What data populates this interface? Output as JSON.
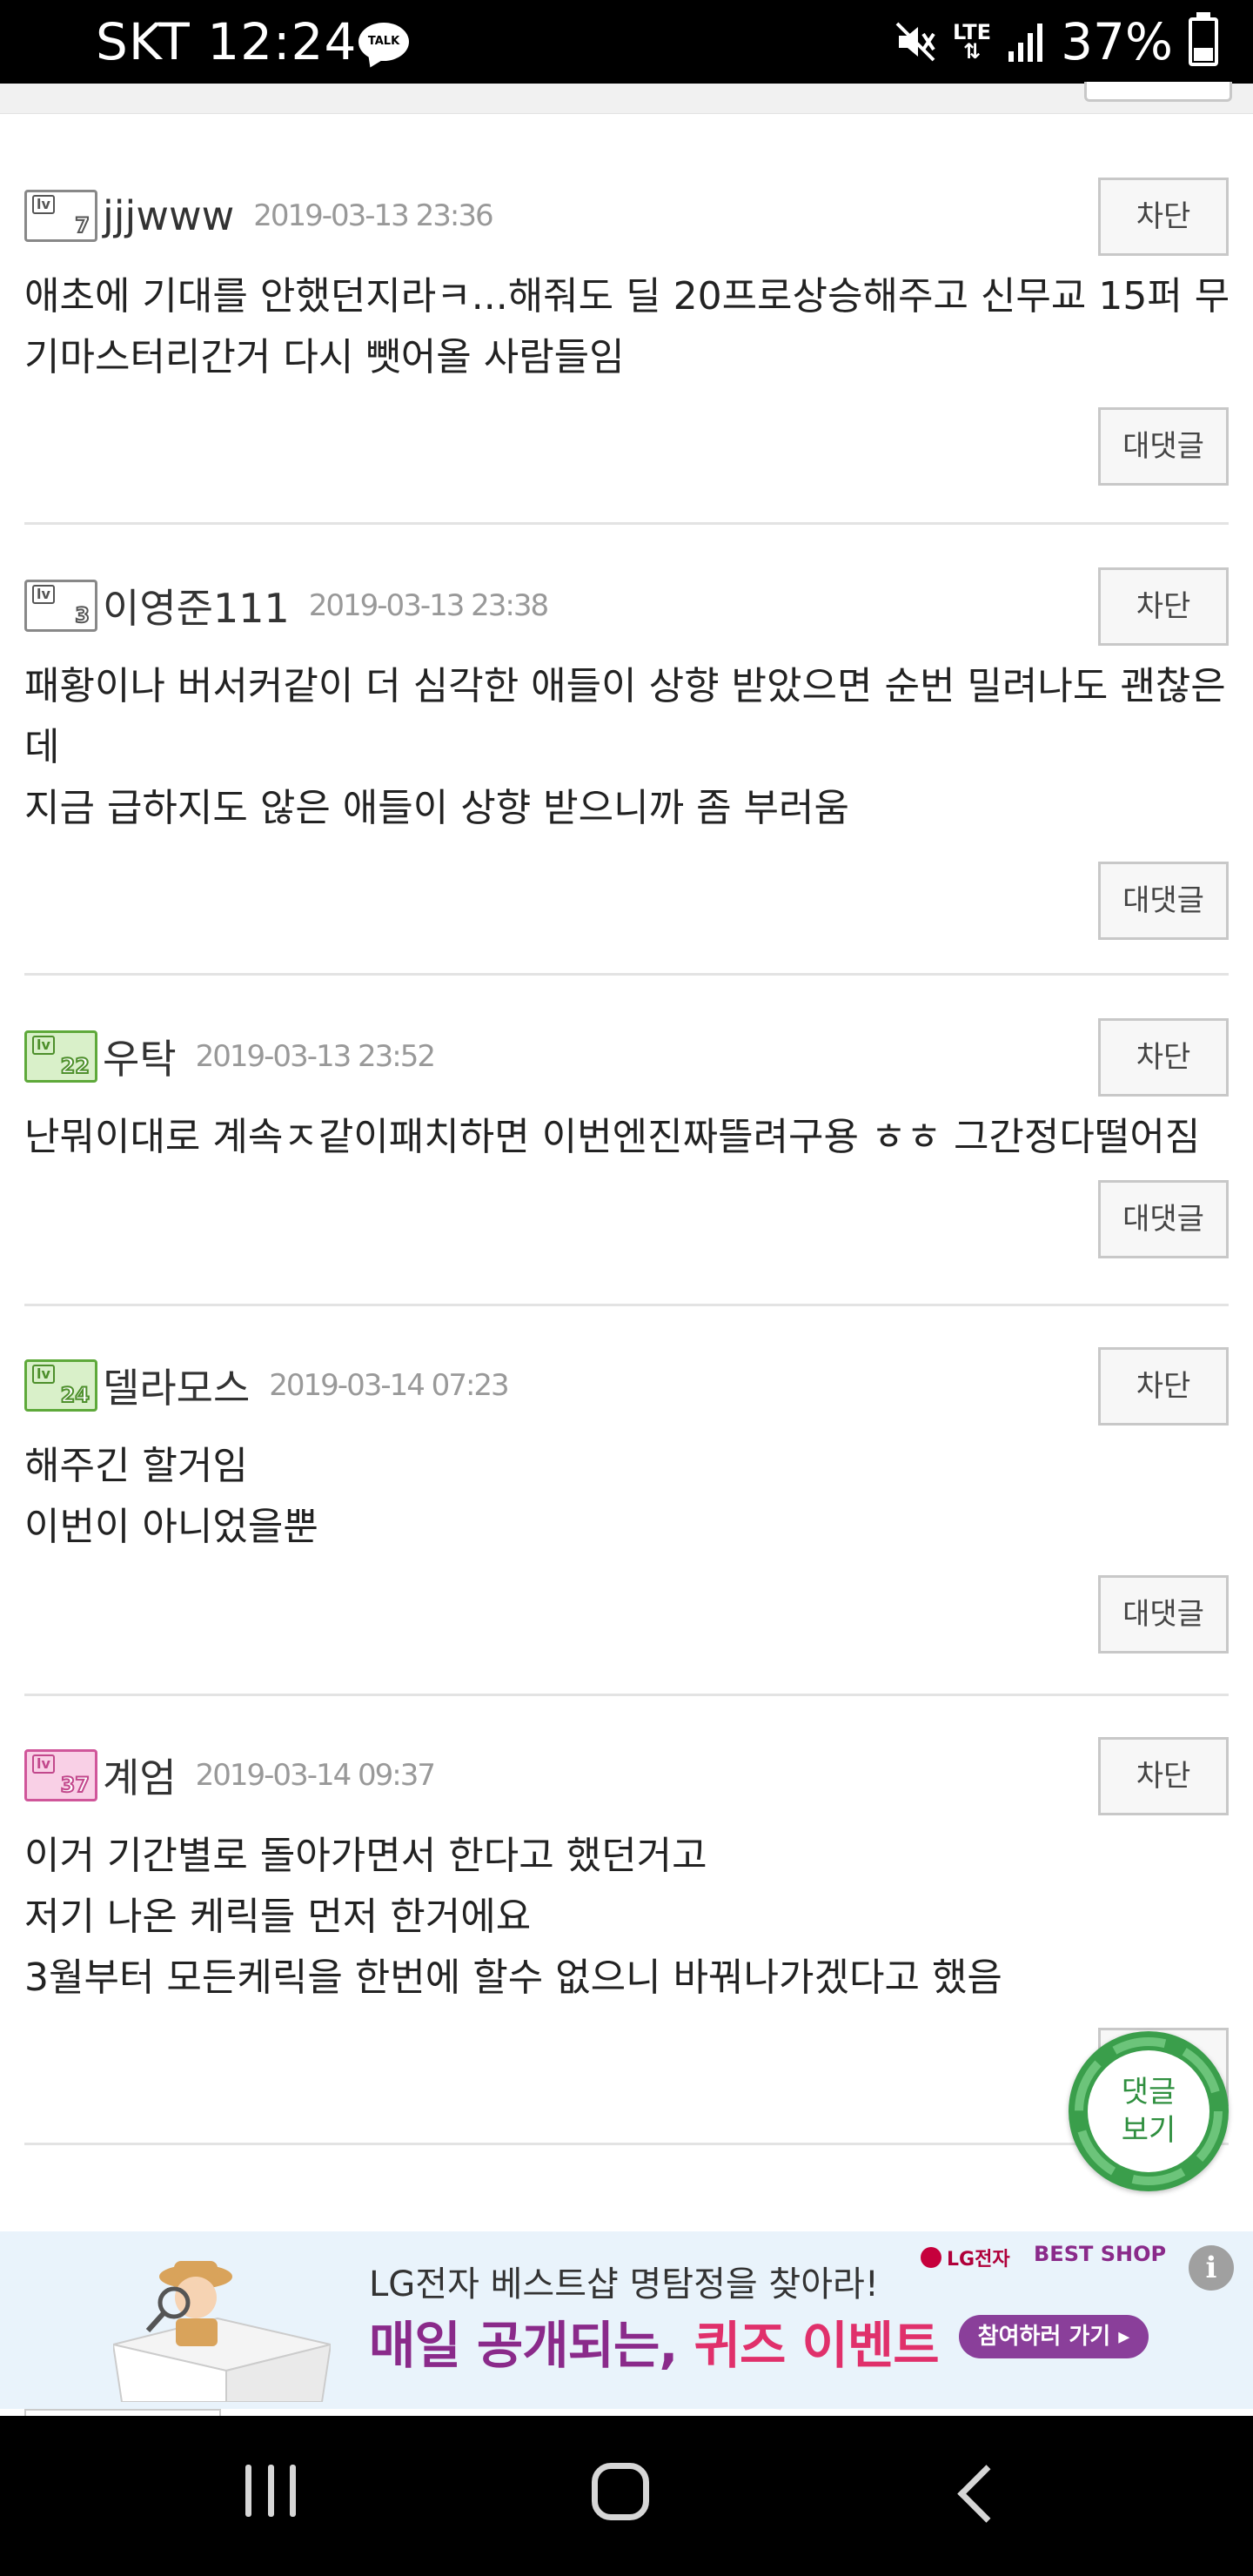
{
  "status_bar": {
    "carrier_time": "SKT 12:24",
    "talk_icon_text": "TALK",
    "network": "LTE",
    "battery": "37%"
  },
  "comments": [
    {
      "level": "7",
      "nickname": "jjjwww",
      "date": "2019-03-13 23:36",
      "lines": [
        "애초에 기대를 안했던지라ㅋ...해줘도 딜 20프로상승해주고 신무교 15퍼 무",
        "기마스터리간거 다시 뺏어올 사람들임"
      ],
      "block_label": "차단",
      "reply_label": "대댓글"
    },
    {
      "level": "3",
      "nickname": "이영준111",
      "date": "2019-03-13 23:38",
      "lines": [
        "패황이나 버서커같이 더 심각한 애들이 상향 받았으면 순번 밀려나도 괜찮은",
        "데",
        "지금 급하지도 않은 애들이 상향 받으니까 좀 부러움"
      ],
      "block_label": "차단",
      "reply_label": "대댓글"
    },
    {
      "level": "22",
      "nickname": "우탁",
      "date": "2019-03-13 23:52",
      "lines": [
        "난뭐이대로 계속ㅈ같이패치하면 이번엔진짜뜰려구용 ㅎㅎ 그간정다떨어짐"
      ],
      "block_label": "차단",
      "reply_label": "대댓글"
    },
    {
      "level": "24",
      "nickname": "델라모스",
      "date": "2019-03-14 07:23",
      "lines": [
        "해주긴 할거임",
        "이번이 아니었을뿐"
      ],
      "block_label": "차단",
      "reply_label": "대댓글"
    },
    {
      "level": "37",
      "nickname": "계엄",
      "date": "2019-03-14 09:37",
      "lines": [
        "이거 기간별로 돌아가면서 한다고 했던거고",
        "저기 나온 케릭들 먼저 한거에요",
        "3월부터 모든케릭을 한번에 할수 없으니 바꿔나가겠다고 했음"
      ],
      "block_label": "차단",
      "reply_label": "대댓글"
    }
  ],
  "fab": {
    "line1": "댓글",
    "line2": "보기"
  },
  "ad": {
    "line1": "LG전자 베스트샵 명탐정을 찾아라!",
    "line2_a": "매일 공개되는, ",
    "line2_b": "퀴즈 이벤트",
    "lg_label": "LG전자",
    "best_shop": "BEST SHOP",
    "cta": "참여하러 가기 ▸",
    "info": "i"
  },
  "colors": {
    "badge_gray": "#888888",
    "badge_green": "#5ea93a",
    "badge_pink": "#d0569a",
    "fab_green": "#3a9e4b",
    "ad_purple": "#8a2a8a",
    "ad_pink": "#e0306b"
  }
}
